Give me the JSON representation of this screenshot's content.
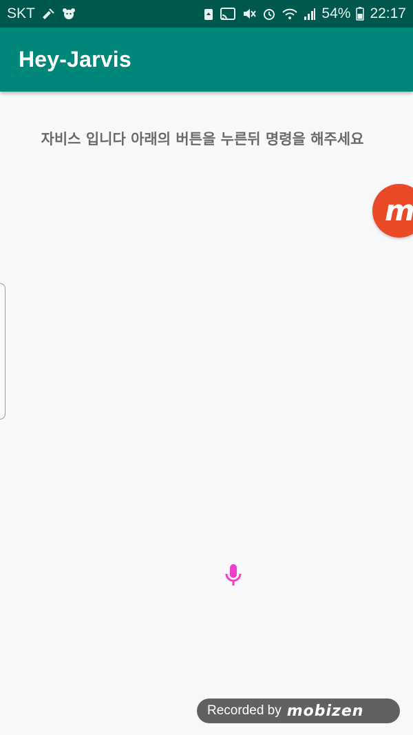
{
  "status_bar": {
    "carrier": "SKT",
    "battery_percent": "54%",
    "time": "22:17",
    "icons": [
      "flashlight-icon",
      "bear-icon",
      "recycle-icon",
      "cast-icon",
      "mute-icon",
      "alarm-icon",
      "wifi-icon",
      "signal-icon",
      "battery-icon"
    ]
  },
  "app_bar": {
    "title": "Hey-Jarvis"
  },
  "main": {
    "instruction": "자비스 입니다 아래의 버튼을 누른뒤 명령을 해주세요",
    "mic_button_icon": "microphone-icon"
  },
  "overlay": {
    "badge_letter": "m",
    "recorder_label": "Recorded by",
    "recorder_brand": "mobizen"
  },
  "colors": {
    "status_bar": "#00574b",
    "app_bar": "#00877a",
    "accent": "#f03ccf",
    "background": "#f9f8fb",
    "badge": "#ea4a27"
  }
}
